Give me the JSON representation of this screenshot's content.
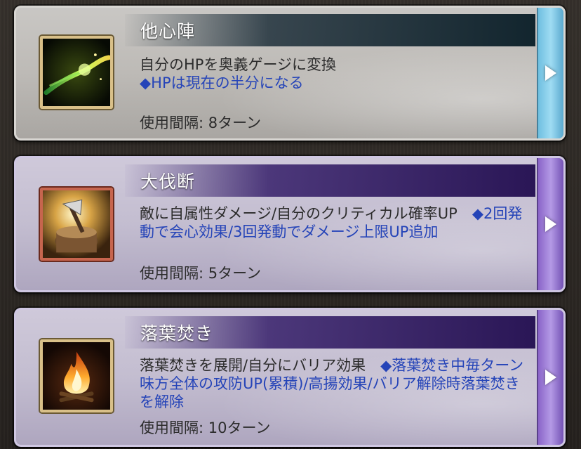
{
  "skills": [
    {
      "name": "他心陣",
      "description_main": "自分のHPを奥義ゲージに変換",
      "description_note": "◆HPは現在の半分になる",
      "interval": "使用間隔: 8ターン",
      "icon": "green-wave-icon"
    },
    {
      "name": "大伐断",
      "description_main": "敵に自属性ダメージ/自分のクリティカル確率UP　",
      "description_note": "◆2回発動で会心効果/3回発動でダメージ上限UP追加",
      "interval": "使用間隔: 5ターン",
      "icon": "axe-stump-icon"
    },
    {
      "name": "落葉焚き",
      "description_main": "落葉焚きを展開/自分にバリア効果　",
      "description_note": "◆落葉焚き中毎ターン味方全体の攻防UP(累積)/高揚効果/バリア解除時落葉焚きを解除",
      "interval": "使用間隔: 10ターン",
      "icon": "bonfire-icon"
    }
  ],
  "colors": {
    "note_text": "#2544b8",
    "grey_tab": "#9fdcf3",
    "purple_tab": "#b49ae6"
  }
}
